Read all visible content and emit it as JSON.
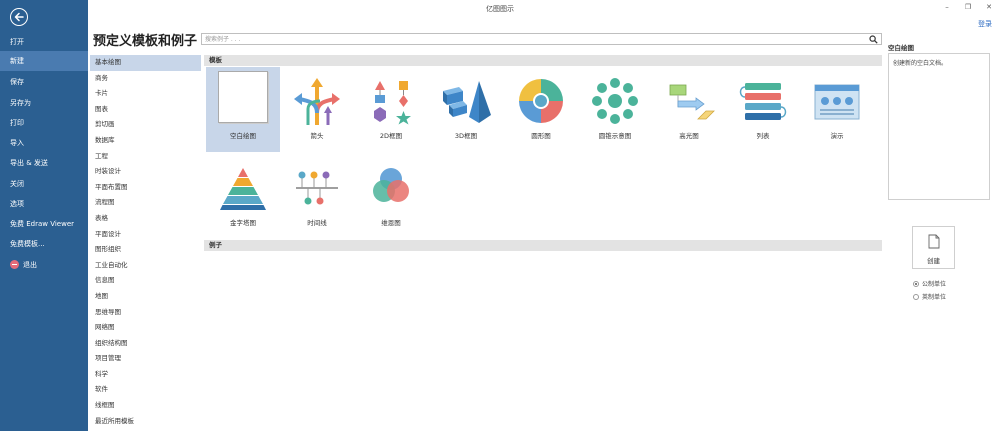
{
  "window": {
    "title": "亿图图示",
    "minimize": "–",
    "restore": "❐",
    "close": "✕",
    "login": "登录"
  },
  "sidebar": {
    "items": [
      {
        "label": "打开"
      },
      {
        "label": "新建"
      },
      {
        "label": "保存"
      },
      {
        "label": "另存为"
      },
      {
        "label": "打印"
      },
      {
        "label": "导入"
      },
      {
        "label": "导出 & 发送"
      },
      {
        "label": "关闭"
      },
      {
        "label": "选项"
      },
      {
        "label": "免费 Edraw Viewer"
      },
      {
        "label": "免费模板..."
      },
      {
        "label": "退出"
      }
    ]
  },
  "main": {
    "title": "预定义模板和例子",
    "search": {
      "placeholder": "搜索例子 . . ."
    },
    "categories": [
      "基本绘图",
      "商务",
      "卡片",
      "图表",
      "剪切画",
      "数据库",
      "工程",
      "时装设计",
      "平面布置图",
      "流程图",
      "表格",
      "平面设计",
      "图形组织",
      "工业自动化",
      "信息图",
      "地图",
      "思维导图",
      "网络图",
      "组织结构图",
      "项目管理",
      "科学",
      "软件",
      "线框图",
      "最近所用模板"
    ],
    "templates_header": "模板",
    "examples_header": "例子",
    "templates": [
      {
        "label": "空白绘图"
      },
      {
        "label": "箭头"
      },
      {
        "label": "2D框图"
      },
      {
        "label": "3D框图"
      },
      {
        "label": "圆形图"
      },
      {
        "label": "圆锥示意图"
      },
      {
        "label": "高光图"
      },
      {
        "label": "列表"
      },
      {
        "label": "演示"
      },
      {
        "label": "金字塔图"
      },
      {
        "label": "时间线"
      },
      {
        "label": "维恩图"
      }
    ]
  },
  "right_panel": {
    "title": "空白绘图",
    "description": "创建新的空白文档。",
    "create_label": "创建",
    "units": [
      {
        "label": "公制单位",
        "checked": true
      },
      {
        "label": "英制单位",
        "checked": false
      }
    ]
  },
  "colors": {
    "sidebar": "#2b5f91",
    "sidebar_active": "#4a7bb0",
    "selection": "#c8d6e9",
    "link": "#2b6ac2"
  }
}
